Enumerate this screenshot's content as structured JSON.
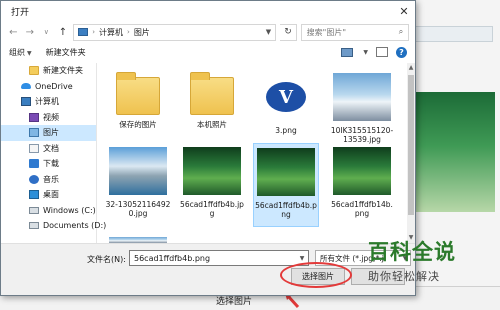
{
  "dialog": {
    "title": "打开",
    "close_glyph": "✕"
  },
  "address": {
    "back": "←",
    "forward": "→",
    "recent": "∨",
    "up": "↑",
    "path": [
      "计算机",
      "图片"
    ],
    "separator": "›",
    "refresh": "↻",
    "search_placeholder": "搜索\"图片\""
  },
  "toolbar": {
    "organize": "组织",
    "new_folder": "新建文件夹",
    "help": "?"
  },
  "nav": {
    "items": [
      {
        "label": "新建文件夹",
        "icon": "folder-icon",
        "kind": "top"
      },
      {
        "label": "OneDrive",
        "icon": "cloud-icon",
        "kind": "root"
      },
      {
        "label": "计算机",
        "icon": "computer-icon",
        "kind": "root"
      },
      {
        "label": "视频",
        "icon": "video-icon",
        "kind": "sub"
      },
      {
        "label": "图片",
        "icon": "pictures-icon",
        "kind": "sub",
        "selected": true
      },
      {
        "label": "文档",
        "icon": "documents-icon",
        "kind": "sub"
      },
      {
        "label": "下载",
        "icon": "download-icon",
        "kind": "sub"
      },
      {
        "label": "音乐",
        "icon": "music-icon",
        "kind": "sub"
      },
      {
        "label": "桌面",
        "icon": "desktop-icon",
        "kind": "sub"
      },
      {
        "label": "Windows (C:)",
        "icon": "drive-icon",
        "kind": "sub"
      },
      {
        "label": "Documents (D:)",
        "icon": "drive-icon",
        "kind": "sub"
      }
    ]
  },
  "files": [
    {
      "name": "保存的图片",
      "kind": "folder"
    },
    {
      "name": "本机照片",
      "kind": "folder"
    },
    {
      "name": "3.png",
      "kind": "v-logo"
    },
    {
      "name": "10IK315515120-13539.jpg",
      "kind": "mountain"
    },
    {
      "name": "32-130521164920.jpg",
      "kind": "lake"
    },
    {
      "name": "56cad1ffdfb4b.jpg",
      "kind": "forest"
    },
    {
      "name": "56cad1ffdfb4b.png",
      "kind": "forest",
      "selected": true
    },
    {
      "name": "56cad1ffdfb14b.png",
      "kind": "forest"
    }
  ],
  "footer": {
    "filename_label": "文件名(N):",
    "filename_value": "56cad1ffdfb4b.png",
    "type_filter": "所有文件 (*.jpg;*.j",
    "select_button": "选择图片",
    "cancel_button": ""
  },
  "background": {
    "select_text": "选择图片"
  },
  "watermark": {
    "main": "百科全说",
    "sub": "助你轻松解决"
  },
  "colors": {
    "selection": "#cce8ff",
    "annotation": "#e33a3a",
    "watermark": "#2b7a2b"
  }
}
